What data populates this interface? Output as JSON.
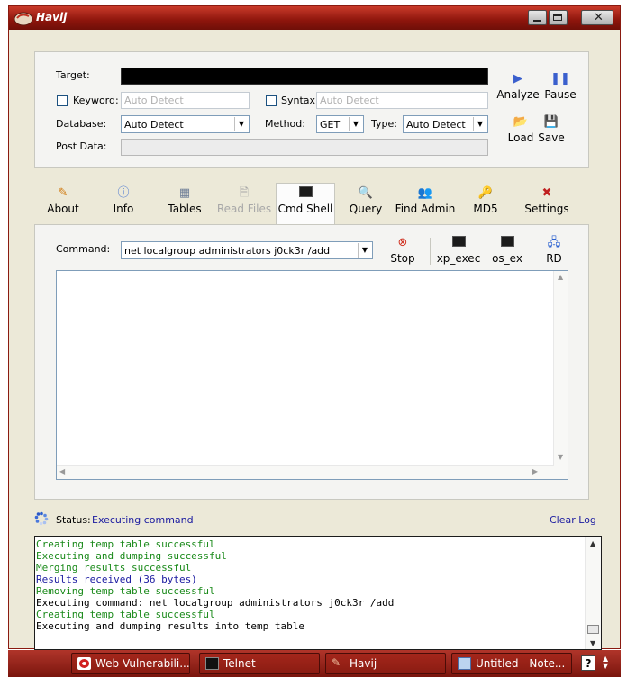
{
  "window": {
    "title": "Havij"
  },
  "target_panel": {
    "target_label": "Target:",
    "keyword_label": "Keyword:",
    "keyword_placeholder": "Auto Detect",
    "syntax_label": "Syntax:",
    "syntax_placeholder": "Auto Detect",
    "database_label": "Database:",
    "database_value": "Auto Detect",
    "method_label": "Method:",
    "method_value": "GET",
    "type_label": "Type:",
    "type_value": "Auto Detect",
    "postdata_label": "Post Data:",
    "analyze_label": "Analyze",
    "pause_label": "Pause",
    "load_label": "Load",
    "save_label": "Save"
  },
  "toolbar": {
    "items": [
      {
        "label": "About",
        "icon": "about-icon"
      },
      {
        "label": "Info",
        "icon": "info-icon"
      },
      {
        "label": "Tables",
        "icon": "tables-icon"
      },
      {
        "label": "Read Files",
        "icon": "read-files-icon",
        "disabled": true
      },
      {
        "label": "Cmd Shell",
        "icon": "cmd-shell-icon",
        "active": true
      },
      {
        "label": "Query",
        "icon": "query-icon"
      },
      {
        "label": "Find Admin",
        "icon": "find-admin-icon"
      },
      {
        "label": "MD5",
        "icon": "md5-icon"
      },
      {
        "label": "Settings",
        "icon": "settings-icon"
      }
    ]
  },
  "cmd_panel": {
    "command_label": "Command:",
    "command_value": "net localgroup administrators j0ck3r /add",
    "stop_label": "Stop",
    "xp_exec_label": "xp_exec",
    "os_ex_label": "os_ex",
    "rd_label": "RD"
  },
  "status": {
    "label": "Status:",
    "value": "Executing command",
    "clear_log": "Clear Log"
  },
  "log": {
    "lines": [
      {
        "text": "Creating temp table successful",
        "color": "#1a8a1a"
      },
      {
        "text": "Executing and dumping successful",
        "color": "#1a8a1a"
      },
      {
        "text": "Merging results successful",
        "color": "#1a8a1a"
      },
      {
        "text": "Results received (36 bytes)",
        "color": "#1a1aa0"
      },
      {
        "text": "Removing temp table successful",
        "color": "#1a8a1a"
      },
      {
        "text": "Executing command: net localgroup administrators j0ck3r /add",
        "color": "#000000"
      },
      {
        "text": "Creating temp table successful",
        "color": "#1a8a1a"
      },
      {
        "text": "Executing and dumping results into temp table",
        "color": "#000000"
      }
    ]
  },
  "taskbar": {
    "tasks": [
      {
        "label": "Web Vulnerabili...",
        "icon": "opera-icon"
      },
      {
        "label": "Telnet",
        "icon": "console-icon"
      },
      {
        "label": "Havij",
        "icon": "havij-icon"
      },
      {
        "label": "Untitled - Note...",
        "icon": "notepad-icon"
      }
    ],
    "help": "?"
  },
  "colors": {
    "accent": "#8d150c",
    "link": "#1a1aa0",
    "success": "#1a8a1a"
  }
}
